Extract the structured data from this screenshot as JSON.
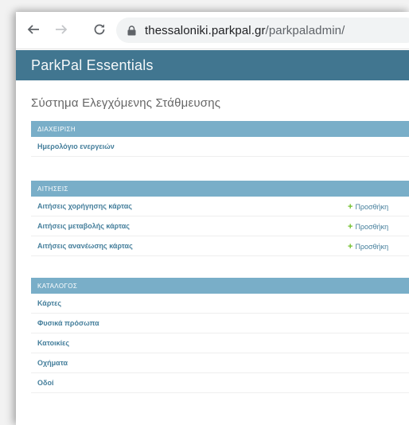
{
  "browser": {
    "url_host": "thessaloniki.parkpal.gr",
    "url_path": "/parkpaladmin/"
  },
  "header": {
    "site_title": "ParkPal Essentials"
  },
  "page": {
    "title": "Σύστημα Ελεγχόμενης Στάθμευσης"
  },
  "modules": {
    "admin": {
      "caption": "ΔΙΑΧΕΙΡΙΣΗ",
      "items": [
        {
          "label": "Ημερολόγιο ενεργειών"
        }
      ]
    },
    "requests": {
      "caption": "ΑΙΤΗΣΕΙΣ",
      "add_label": "Προσθήκη",
      "items": [
        {
          "label": "Αιτήσεις χορήγησης κάρτας"
        },
        {
          "label": "Αιτήσεις μεταβολής κάρτας"
        },
        {
          "label": "Αιτήσεις ανανέωσης κάρτας"
        }
      ]
    },
    "catalog": {
      "caption": "ΚΑΤΑΛΟΓΟΣ",
      "items": [
        {
          "label": "Κάρτες"
        },
        {
          "label": "Φυσικά πρόσωπα"
        },
        {
          "label": "Κατοικίες"
        },
        {
          "label": "Οχήματα"
        },
        {
          "label": "Οδοί"
        }
      ]
    }
  },
  "colors": {
    "header_bg": "#417690",
    "module_caption_bg": "#79aec8",
    "link": "#447e9b",
    "add_icon": "#70bf2b"
  }
}
